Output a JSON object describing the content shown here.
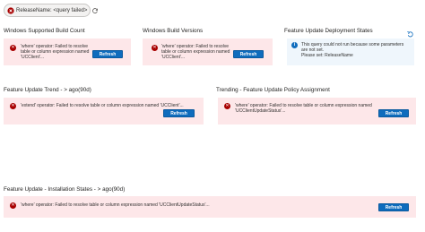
{
  "parameter": {
    "label": "ReleaseName: <query failed>",
    "icons": [
      "error-icon",
      "refresh-icon"
    ]
  },
  "colors": {
    "error_bg": "#fde7e9",
    "error_icon": "#a80000",
    "info_bg": "#eff6fc",
    "accent": "#0f6cbd"
  },
  "tiles": {
    "build_count": {
      "title": "Windows Supported Build Count",
      "error": "'where' operator: Failed to resolve table or column expression named 'UCClient'...",
      "refresh": "Refresh"
    },
    "build_versions": {
      "title": "Windows Build Versions",
      "error": "'where' operator: Failed to resolve table or column expression named 'UCClient'...",
      "refresh": "Refresh"
    },
    "deployment_states": {
      "title": "Feature Update Deployment States",
      "info_line1": "This query could not run because some parameters",
      "info_line2": "are not set.",
      "info_line3": "Please set: ReleaseName"
    },
    "trend": {
      "title": "Feature Update Trend - > ago(90d)",
      "error": "'extend' operator: Failed to resolve table or column expression named 'UCClient'...",
      "refresh": "Refresh"
    },
    "policy_trend": {
      "title": "Trending - Feature Update Policy Assignment",
      "error_line1": "'where' operator: Failed to resolve table or column expression named",
      "error_line2": "'UCClientUpdateStatus'...",
      "refresh": "Refresh"
    },
    "install_states": {
      "title": "Feature Update - Installation States - > ago(90d)",
      "error": "'where' operator: Failed to resolve table or column expression named 'UCClientUpdateStatus'...",
      "refresh": "Refresh"
    }
  }
}
